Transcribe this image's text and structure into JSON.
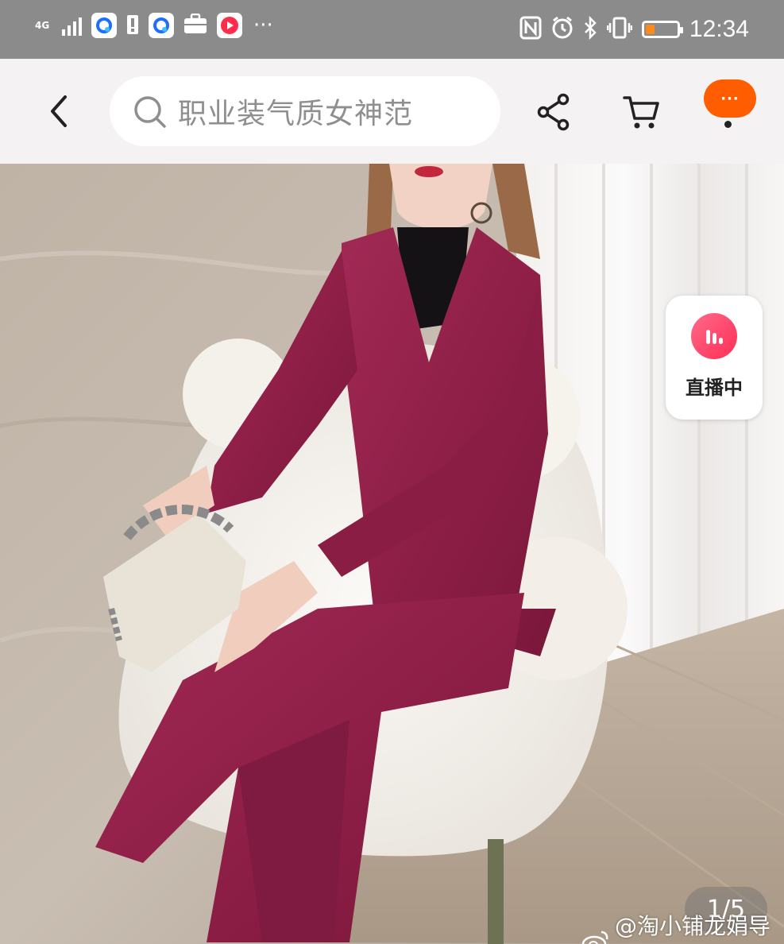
{
  "status_bar": {
    "network": "4G",
    "time": "12:34",
    "more": "···",
    "battery_level": 0.3,
    "battery_color": "#ff8a1c"
  },
  "nav": {
    "back_icon": "chevron-left-icon",
    "search_placeholder": "职业装气质女神范",
    "share_icon": "share-icon",
    "cart_icon": "cart-icon",
    "more_label": "···",
    "more_color": "#ff5d00"
  },
  "product": {
    "live_badge": "直播中",
    "pager": "1/5",
    "watermark": "@淘小铺龙娟导师"
  }
}
